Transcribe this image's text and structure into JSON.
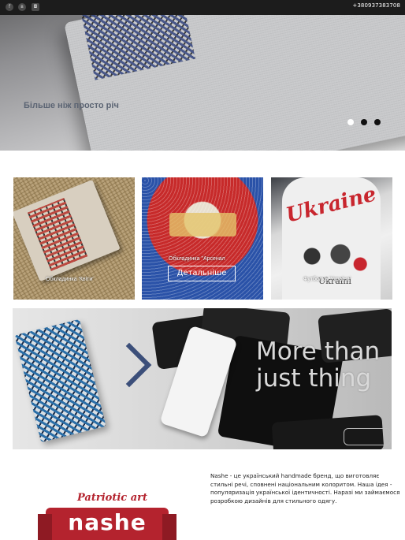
{
  "topbar": {
    "social": [
      {
        "icon": "facebook-icon",
        "glyph": "f"
      },
      {
        "icon": "vk-icon",
        "glyph": "в"
      },
      {
        "icon": "instagram-icon",
        "glyph": "◘"
      }
    ],
    "phone": "+380937383708",
    "background": "#1c1c1c"
  },
  "hero": {
    "tagline": "Більше ніж просто річ",
    "slide_count": 3,
    "active_slide": 0
  },
  "products": [
    {
      "caption": "Обкладинка 'Квіти'"
    },
    {
      "caption": "Обкладинка \"Арсенал",
      "button_label": "Детальніше"
    },
    {
      "caption": "Футболка 'Україна'"
    }
  ],
  "banner": {
    "headline": "More than just thing",
    "logo_text": "nashe"
  },
  "logo": {
    "script": "Patriotic art",
    "word": "nashe",
    "brand_color": "#b4232e"
  },
  "about": {
    "text": "Nashe - це український handmade бренд, що виготовляє стильні речі, сповнені національним колоритом. Наша ідея - популяризація української ідентичності. Наразі ми займаємося розробкою дизайнів для стильного одягу."
  }
}
